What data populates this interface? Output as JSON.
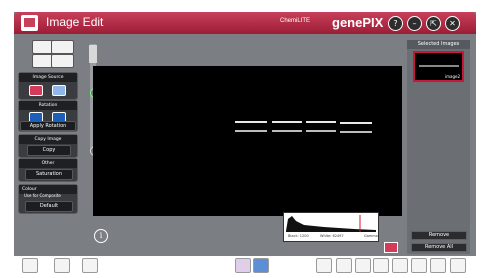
{
  "window": {
    "title": "Image Edit",
    "brand_small": "ChemiLITE",
    "brand_big": "genePIX",
    "controls": [
      {
        "name": "help-button",
        "glyph": "?"
      },
      {
        "name": "minimize-button",
        "glyph": "–"
      },
      {
        "name": "restore-button",
        "glyph": "⇱"
      },
      {
        "name": "close-button",
        "glyph": "✕"
      }
    ]
  },
  "left_panel": {
    "image_source_label": "Image Source",
    "rotation_label": "Rotation",
    "apply_rotation_label": "Apply Rotation",
    "copy_image_label": "Copy Image",
    "copy_button_label": "Copy",
    "other_label": "Other",
    "saturation_label": "Saturation",
    "colour_label": "Colour",
    "use_for_composite_label": "Use for Composite",
    "default_label": "Default"
  },
  "histogram": {
    "black_label": "Black: 1200",
    "white_label": "White: 62497",
    "scale_label": "Gamma"
  },
  "right_panel": {
    "selected_images_label": "Selected Images",
    "thumbnail_label": "image2",
    "remove_label": "Remove",
    "remove_all_label": "Remove All"
  },
  "colors": {
    "accent": "#c8405a",
    "panel": "#7b7e83",
    "canvas": "#000000"
  }
}
